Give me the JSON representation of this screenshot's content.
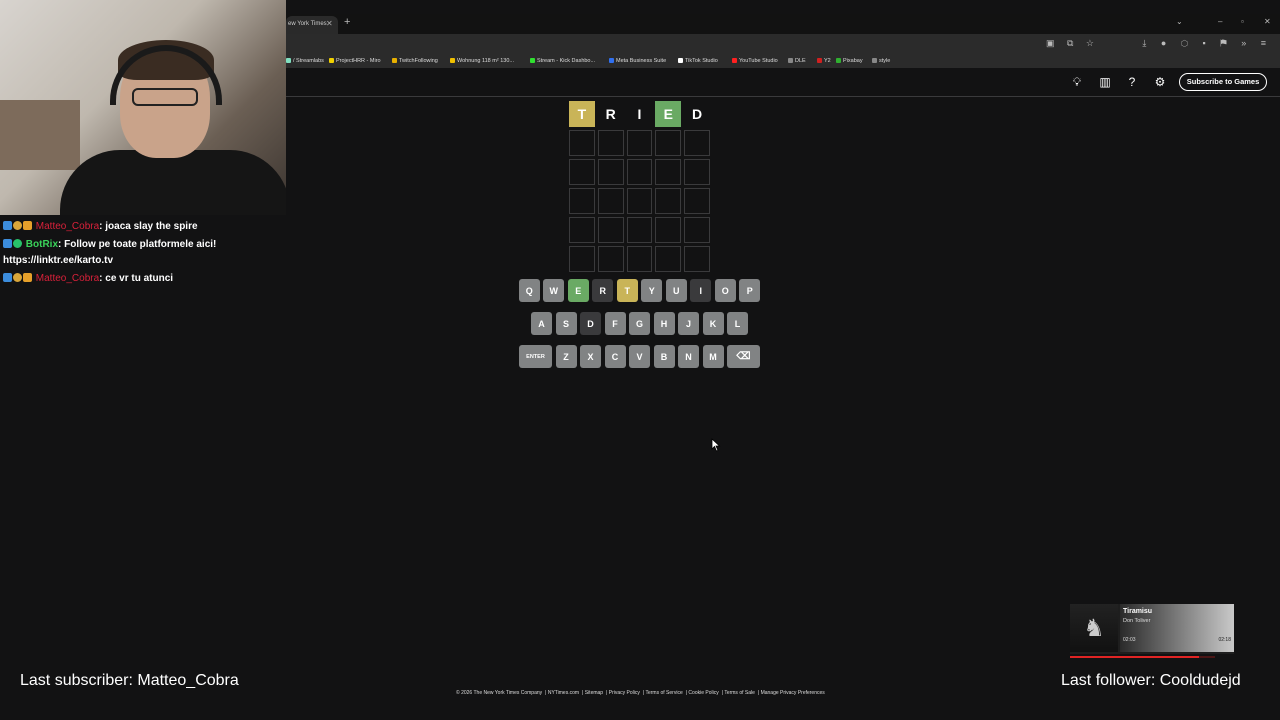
{
  "browser": {
    "tab_title": "ew York Times",
    "bookmarks": [
      {
        "label": "/ Streamlabs",
        "color": "#80e0c0"
      },
      {
        "label": "ProjectHRR - Miro",
        "color": "#f0d000"
      },
      {
        "label": "TwitchFollowing",
        "color": "#e8b000"
      },
      {
        "label": "Wohnung 118 m² 130...",
        "color": "#f0c000"
      },
      {
        "label": "Stream - Kick Dashbo...",
        "color": "#30e030"
      },
      {
        "label": "Meta Business Suite",
        "color": "#3070f0"
      },
      {
        "label": "TikTok Studio",
        "color": "#ffffff"
      },
      {
        "label": "YouTube Studio",
        "color": "#ff2020"
      },
      {
        "label": "DLE",
        "color": "#888888"
      },
      {
        "label": "Y2",
        "color": "#d02020"
      },
      {
        "label": "Pixabay",
        "color": "#30b030"
      },
      {
        "label": "style",
        "color": "#888888"
      }
    ]
  },
  "chat": {
    "messages": [
      {
        "user": "Matteo_Cobra",
        "text": ": joaca slay the spire",
        "color": "#d9213a"
      },
      {
        "user": "BotRix",
        "text": ": Follow pe toate platformele aici!",
        "extra": "https://linktr.ee/karto.tv",
        "color": "#3ad35a"
      },
      {
        "user": "Matteo_Cobra",
        "text": ": ce vr tu atunci",
        "color": "#d9213a"
      }
    ]
  },
  "header": {
    "subscribe_label": "Subscribe to Games"
  },
  "board": {
    "rows": [
      [
        {
          "letter": "T",
          "state": "present"
        },
        {
          "letter": "R",
          "state": "absent"
        },
        {
          "letter": "I",
          "state": "absent"
        },
        {
          "letter": "E",
          "state": "correct"
        },
        {
          "letter": "D",
          "state": "absent"
        }
      ]
    ],
    "total_rows": 6,
    "colors": {
      "correct": "#6aaa64",
      "present": "#c9b458",
      "absent": "#121213",
      "key_default": "#818384",
      "key_absent": "#3a3a3c"
    }
  },
  "keyboard": {
    "rows": [
      [
        {
          "k": "Q"
        },
        {
          "k": "W"
        },
        {
          "k": "E",
          "state": "correct"
        },
        {
          "k": "R",
          "state": "absent"
        },
        {
          "k": "T",
          "state": "present"
        },
        {
          "k": "Y"
        },
        {
          "k": "U"
        },
        {
          "k": "I",
          "state": "absent"
        },
        {
          "k": "O"
        },
        {
          "k": "P"
        }
      ],
      [
        {
          "k": "A"
        },
        {
          "k": "S"
        },
        {
          "k": "D",
          "state": "absent"
        },
        {
          "k": "F"
        },
        {
          "k": "G"
        },
        {
          "k": "H"
        },
        {
          "k": "J"
        },
        {
          "k": "K"
        },
        {
          "k": "L"
        }
      ],
      [
        {
          "k": "ENTER",
          "wide": true
        },
        {
          "k": "Z"
        },
        {
          "k": "X"
        },
        {
          "k": "C"
        },
        {
          "k": "V"
        },
        {
          "k": "B"
        },
        {
          "k": "N"
        },
        {
          "k": "M"
        },
        {
          "k": "⌫",
          "wide": true
        }
      ]
    ]
  },
  "footer": {
    "links": [
      "© 2026 The New York Times Company",
      "NYTimes.com",
      "Sitemap",
      "Privacy Policy",
      "Terms of Service",
      "Cookie Policy",
      "Terms of Sale",
      "Manage Privacy Preferences"
    ]
  },
  "overlay": {
    "last_subscriber": "Last subscriber: Matteo_Cobra",
    "last_follower": "Last follower: Cooldudejd",
    "music": {
      "song": "Tiramisu",
      "artist": "Don Toliver",
      "time_current": "02:03",
      "time_total": "02:18",
      "progress": 0.89
    }
  }
}
